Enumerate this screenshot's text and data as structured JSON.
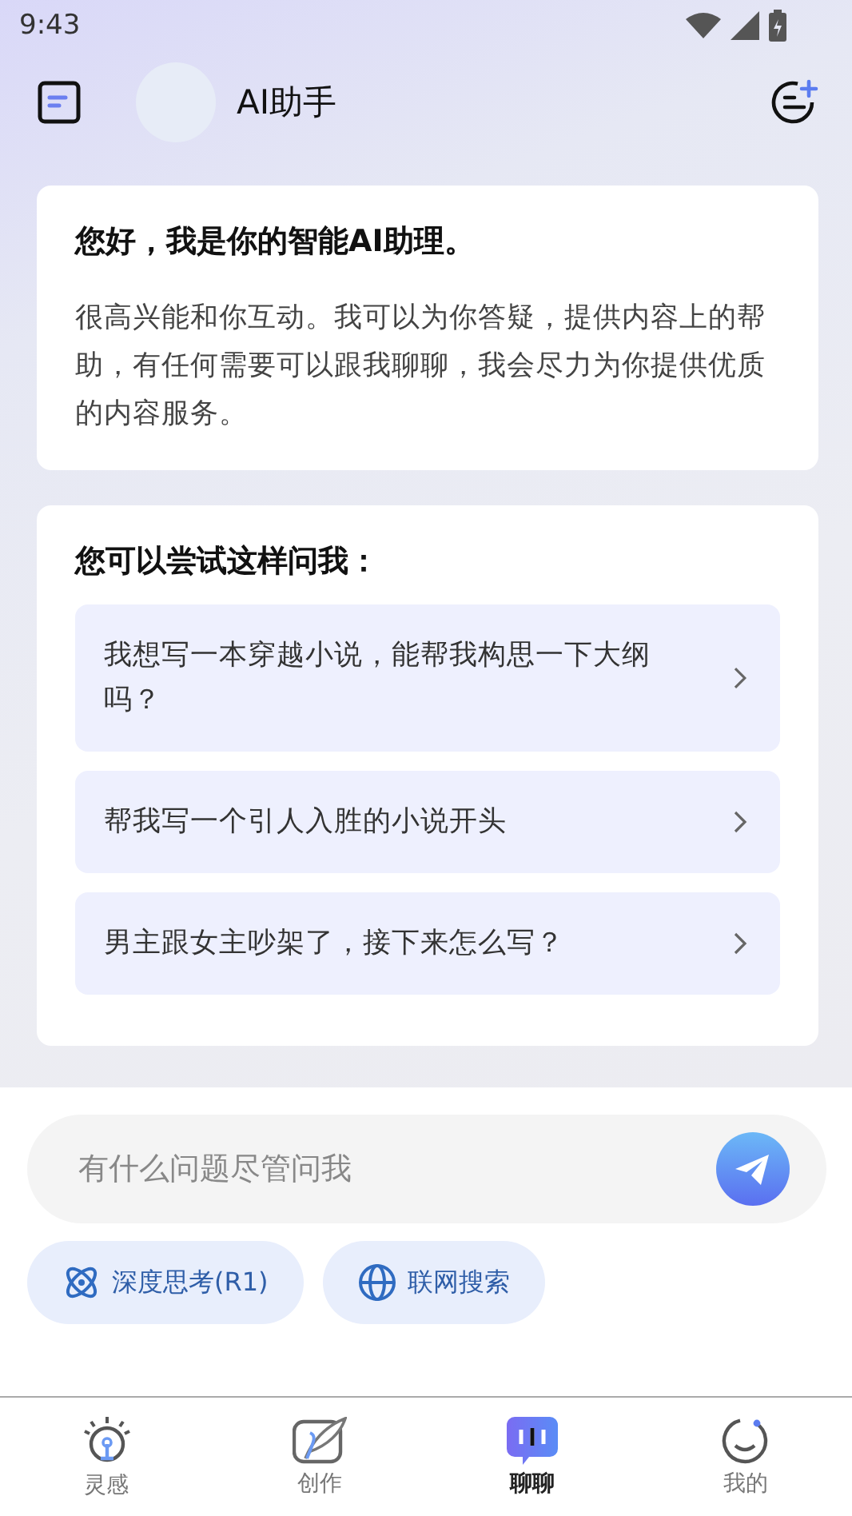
{
  "status_bar": {
    "time": "9:43"
  },
  "header": {
    "title": "AI助手"
  },
  "greeting": {
    "title": "您好，我是你的智能AI助理。",
    "body": "很高兴能和你互动。我可以为你答疑，提供内容上的帮助，有任何需要可以跟我聊聊，我会尽力为你提供优质的内容服务。"
  },
  "suggestions": {
    "title": "您可以尝试这样问我：",
    "items": [
      {
        "text": "我想写一本穿越小说，能帮我构思一下大纲吗？"
      },
      {
        "text": "帮我写一个引人入胜的小说开头"
      },
      {
        "text": "男主跟女主吵架了，接下来怎么写？"
      }
    ]
  },
  "input": {
    "placeholder": "有什么问题尽管问我"
  },
  "chips": [
    {
      "kind": "deep-think",
      "label": "深度思考(R1)",
      "on": false
    },
    {
      "kind": "web-search",
      "label": "联网搜索",
      "on": false
    }
  ],
  "nav": [
    {
      "kind": "bulb",
      "label": "灵感",
      "selected": false
    },
    {
      "kind": "create",
      "label": "创作",
      "selected": false
    },
    {
      "kind": "chat",
      "label": "聊聊",
      "selected": true
    },
    {
      "kind": "me",
      "label": "我的",
      "selected": false
    }
  ]
}
